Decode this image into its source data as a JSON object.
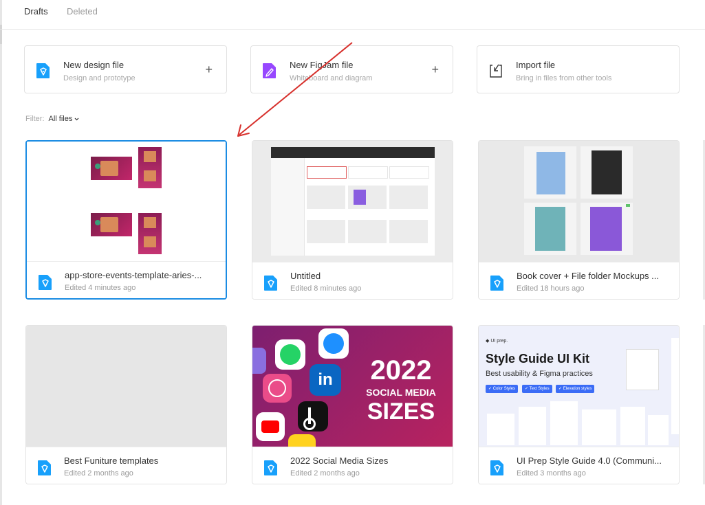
{
  "tabs": [
    "Drafts",
    "Deleted"
  ],
  "actions": [
    {
      "title": "New design file",
      "subtitle": "Design and prototype",
      "icon": "design-file-icon",
      "color": "#18a0fb",
      "has_plus": true
    },
    {
      "title": "New FigJam file",
      "subtitle": "Whiteboard and diagram",
      "icon": "figjam-file-icon",
      "color": "#9747ff",
      "has_plus": true
    },
    {
      "title": "Import file",
      "subtitle": "Bring in files from other tools",
      "icon": "import-icon",
      "color": "#333333",
      "has_plus": false
    }
  ],
  "filter": {
    "label": "Filter:",
    "value": "All files"
  },
  "files": [
    {
      "name": "app-store-events-template-aries-...",
      "edited": "Edited 4 minutes ago",
      "selected": true
    },
    {
      "name": "Untitled",
      "edited": "Edited 8 minutes ago",
      "selected": false
    },
    {
      "name": "Book cover + File folder Mockups ...",
      "edited": "Edited 18 hours ago",
      "selected": false
    },
    {
      "name": "Best Funiture templates",
      "edited": "Edited 2 months ago",
      "selected": false
    },
    {
      "name": "2022 Social Media Sizes",
      "edited": "Edited 2 months ago",
      "selected": false
    },
    {
      "name": "UI Prep Style Guide 4.0 (Communi...",
      "edited": "Edited 3 months ago",
      "selected": false
    }
  ],
  "thumb_text": {
    "social_year": "2022",
    "social_line1": "SOCIAL MEDIA",
    "social_line2": "SIZES",
    "uiprep_brand": "UI prep.",
    "uiprep_title": "Style Guide UI Kit",
    "uiprep_subtitle": "Best usability & Figma practices",
    "uiprep_chips": [
      "Color Styles",
      "Text Styles",
      "Elevation styles"
    ]
  },
  "colors": {
    "accent": "#1b8ce3",
    "figma_blue": "#18a0fb",
    "figjam_purple": "#9747ff",
    "arrow_red": "#d7302c"
  }
}
